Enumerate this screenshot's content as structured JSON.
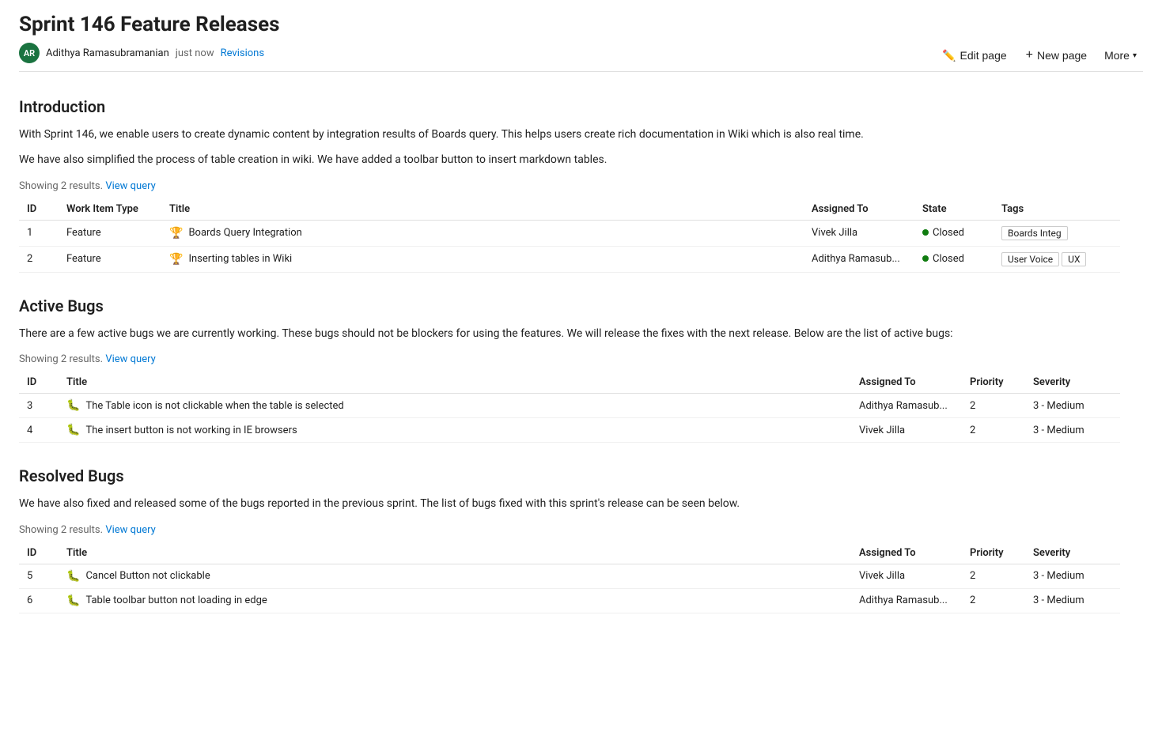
{
  "page": {
    "title": "Sprint 146 Feature Releases",
    "author": {
      "initials": "AR",
      "name": "Adithya Ramasubramanian",
      "time": "just now"
    },
    "revisions_label": "Revisions"
  },
  "toolbar": {
    "edit_label": "Edit page",
    "new_page_label": "New page",
    "more_label": "More"
  },
  "introduction": {
    "heading": "Introduction",
    "paragraphs": [
      "With Sprint 146, we enable users to create dynamic content by integration results of Boards query. This helps users create rich documentation in Wiki which is also real time.",
      "We have also simplified the process of table creation in wiki. We have added a toolbar button to insert markdown tables."
    ],
    "query_meta": "Showing 2 results.",
    "view_query_label": "View query",
    "table": {
      "headers": [
        "ID",
        "Work Item Type",
        "Title",
        "Assigned To",
        "State",
        "Tags"
      ],
      "rows": [
        {
          "id": "1",
          "type": "Feature",
          "type_icon": "🏆",
          "title": "Boards Query Integration",
          "assigned_to": "Vivek Jilla",
          "state": "Closed",
          "tags": [
            "Boards Integ"
          ]
        },
        {
          "id": "2",
          "type": "Feature",
          "type_icon": "🏆",
          "title": "Inserting tables in Wiki",
          "assigned_to": "Adithya Ramasub...",
          "state": "Closed",
          "tags": [
            "User Voice",
            "UX"
          ]
        }
      ]
    }
  },
  "active_bugs": {
    "heading": "Active Bugs",
    "paragraph": "There are a few active bugs we are currently working. These bugs should not be blockers for using the features. We will release the fixes with the next release. Below are the list of active bugs:",
    "query_meta": "Showing 2 results.",
    "view_query_label": "View query",
    "table": {
      "headers": [
        "ID",
        "Title",
        "Assigned To",
        "Priority",
        "Severity"
      ],
      "rows": [
        {
          "id": "3",
          "title": "The Table icon is not clickable when the table is selected",
          "assigned_to": "Adithya Ramasub...",
          "priority": "2",
          "severity": "3 - Medium"
        },
        {
          "id": "4",
          "title": "The insert button is not working in IE browsers",
          "assigned_to": "Vivek Jilla",
          "priority": "2",
          "severity": "3 - Medium"
        }
      ]
    }
  },
  "resolved_bugs": {
    "heading": "Resolved Bugs",
    "paragraph": "We have also fixed and released some of the bugs reported in the previous sprint. The list of bugs fixed with this sprint's release can be seen below.",
    "query_meta": "Showing 2 results.",
    "view_query_label": "View query",
    "table": {
      "headers": [
        "ID",
        "Title",
        "Assigned To",
        "Priority",
        "Severity"
      ],
      "rows": [
        {
          "id": "5",
          "title": "Cancel Button not clickable",
          "assigned_to": "Vivek Jilla",
          "priority": "2",
          "severity": "3 - Medium"
        },
        {
          "id": "6",
          "title": "Table toolbar button not loading in edge",
          "assigned_to": "Adithya Ramasub...",
          "priority": "2",
          "severity": "3 - Medium"
        }
      ]
    }
  },
  "colors": {
    "accent": "#0078d4",
    "status_closed": "#107c10",
    "avatar_bg": "#1a7340"
  }
}
